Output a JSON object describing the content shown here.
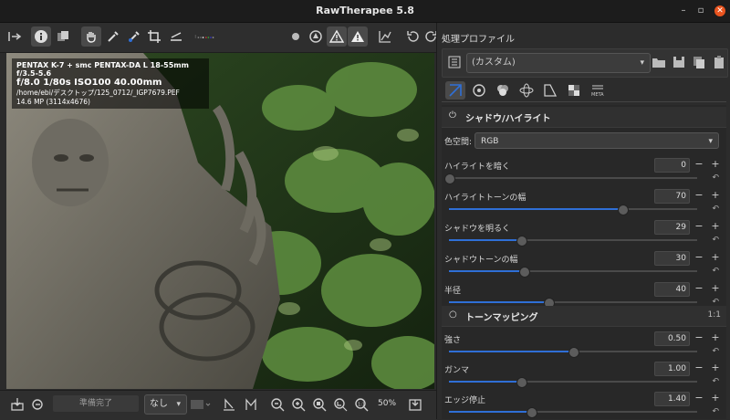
{
  "window": {
    "title": "RawTherapee 5.8"
  },
  "image_info": {
    "camera": "PENTAX K-7 + smc PENTAX-DA L 18-55mm f/3.5-5.6",
    "exposure": "f/8.0  1/80s  ISO100  40.00mm",
    "path": "/home/ebi/デスクトップ/125_0712/_IGP7679.PEF",
    "resolution": "14.6 MP (3114x4676)"
  },
  "status": {
    "progress_label": "準備完了",
    "select_value": "なし",
    "zoom": "50%"
  },
  "right_panel": {
    "profile_label": "処理プロファイル",
    "profile_value": "(カスタム)"
  },
  "shadows_highlights": {
    "title": "シャドウ/ハイライト",
    "colorspace_label": "色空間:",
    "colorspace_value": "RGB",
    "rows": [
      {
        "label": "ハイライトを暗く",
        "value": "0",
        "fraction": 0.0
      },
      {
        "label": "ハイライトトーンの幅",
        "value": "70",
        "fraction": 0.7
      },
      {
        "label": "シャドウを明るく",
        "value": "29",
        "fraction": 0.29
      },
      {
        "label": "シャドウトーンの幅",
        "value": "30",
        "fraction": 0.3
      },
      {
        "label": "半径",
        "value": "40",
        "fraction": 0.4
      }
    ]
  },
  "tone_mapping": {
    "title": "トーンマッピング",
    "extra": "1:1",
    "rows": [
      {
        "label": "強さ",
        "value": "0.50",
        "fraction": 0.5
      },
      {
        "label": "ガンマ",
        "value": "1.00",
        "fraction": 0.29
      },
      {
        "label": "エッジ停止",
        "value": "1.40",
        "fraction": 0.33
      }
    ]
  },
  "colors": {
    "accent": "#2f6fd6",
    "close": "#e9541f"
  }
}
